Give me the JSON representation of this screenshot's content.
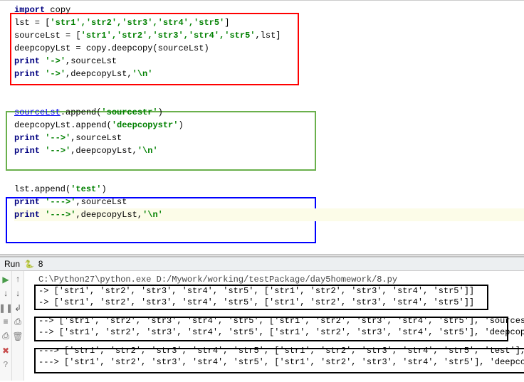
{
  "editor": {
    "lines": {
      "import_kw": "import",
      "import_mod": " copy",
      "l2a": "lst = [",
      "l2b": "'str1','str2','str3','str4','str5'",
      "l2c": "]",
      "l3a": "sourceLst = [",
      "l3b": "'str1','str2','str3','str4','str5'",
      "l3c": ",lst]",
      "l4": "deepcopyLst = copy.deepcopy(sourceLst)",
      "l5a": "print",
      "l5b": " '->'",
      "l5c": ",sourceLst",
      "l6a": "print",
      "l6b": " '->'",
      "l6c": ",deepcopyLst,",
      "l6d": "'\\n'",
      "l8a": "sourceLst",
      "l8b": ".append(",
      "l8c": "'sourcestr'",
      "l8d": ")",
      "l9a": "deepcopyLst.append(",
      "l9b": "'deepcopystr'",
      "l9c": ")",
      "l10a": "print",
      "l10b": " '-->'",
      "l10c": ",sourceLst",
      "l11a": "print",
      "l11b": " '-->'",
      "l11c": ",deepcopyLst,",
      "l11d": "'\\n'",
      "l13a": "lst.append(",
      "l13b": "'test'",
      "l13c": ")",
      "l14a": "print",
      "l14b": " '--->'",
      "l14c": ",sourceLst",
      "l15a": "print",
      "l15b": " '--->'",
      "l15c": ",deepcopyLst,",
      "l15d": "'\\n'"
    }
  },
  "run_header": {
    "label": "Run",
    "script": "8"
  },
  "console": {
    "cmd": "C:\\Python27\\python.exe D:/Mywork/working/testPackage/day5homework/8.py",
    "o1": "-> ['str1', 'str2', 'str3', 'str4', 'str5', ['str1', 'str2', 'str3', 'str4', 'str5']]",
    "o2": "-> ['str1', 'str2', 'str3', 'str4', 'str5', ['str1', 'str2', 'str3', 'str4', 'str5']]",
    "o3": "--> ['str1', 'str2', 'str3', 'str4', 'str5', ['str1', 'str2', 'str3', 'str4', 'str5'], 'sourcestr']",
    "o4": "--> ['str1', 'str2', 'str3', 'str4', 'str5', ['str1', 'str2', 'str3', 'str4', 'str5'], 'deepcopystr']",
    "o5": "---> ['str1', 'str2', 'str3', 'str4', 'str5', ['str1', 'str2', 'str3', 'str4', 'str5', 'test'], 'sourcestr']",
    "o6": "---> ['str1', 'str2', 'str3', 'str4', 'str5', ['str1', 'str2', 'str3', 'str4', 'str5'], 'deepcopystr']"
  },
  "gutter_icons": {
    "play": "▶",
    "down": "↓",
    "pause": "❚❚",
    "misc1": "≡",
    "misc2": "⎙",
    "delete": "✖",
    "help": "?",
    "up": "↑",
    "down2": "↓",
    "wrap": "↲",
    "trash": "🗑"
  }
}
